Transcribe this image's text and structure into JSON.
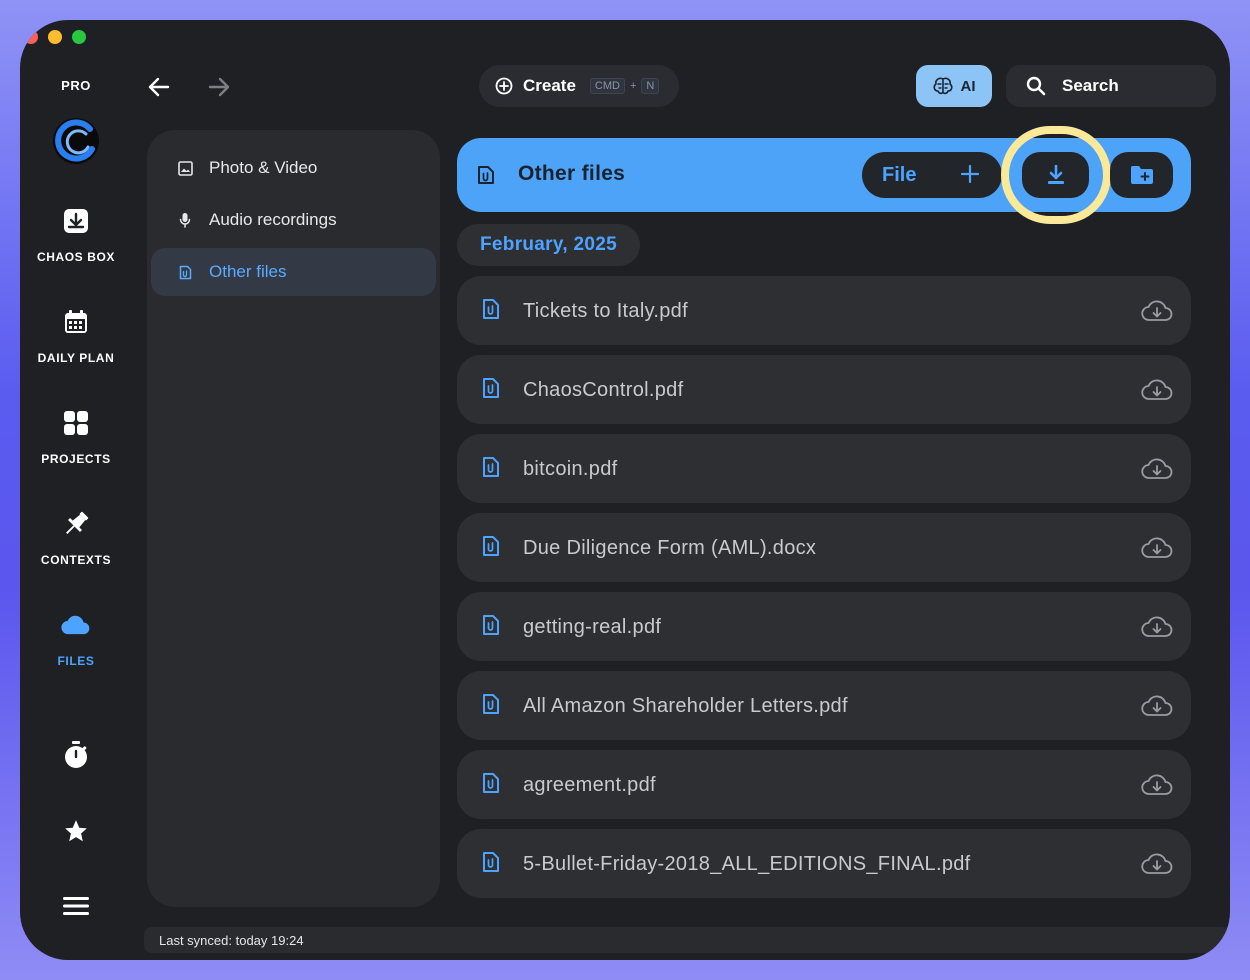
{
  "rail": {
    "plan_label": "PRO",
    "items": [
      {
        "label": "CHAOS BOX",
        "icon": "inbox-download-icon"
      },
      {
        "label": "DAILY PLAN",
        "icon": "calendar-icon"
      },
      {
        "label": "PROJECTS",
        "icon": "grid-icon"
      },
      {
        "label": "CONTEXTS",
        "icon": "pushpin-icon"
      },
      {
        "label": "FILES",
        "icon": "cloud-icon",
        "active": true
      }
    ],
    "bottom_icons": [
      "timer-icon",
      "star-icon",
      "menu-icon"
    ]
  },
  "topbar": {
    "create_label": "Create",
    "shortcut_key1": "CMD",
    "shortcut_plus": "+",
    "shortcut_key2": "N",
    "ai_label": "AI",
    "search_label": "Search"
  },
  "subnav": {
    "items": [
      {
        "label": "Photo & Video",
        "icon": "image-icon"
      },
      {
        "label": "Audio recordings",
        "icon": "microphone-icon"
      },
      {
        "label": "Other files",
        "icon": "attachment-file-icon",
        "active": true
      }
    ]
  },
  "main": {
    "header_title": "Other files",
    "file_button_label": "File",
    "date_group": "February, 2025",
    "files": [
      "Tickets to Italy.pdf",
      "ChaosControl.pdf",
      "bitcoin.pdf",
      "Due Diligence Form (AML).docx",
      "getting-real.pdf",
      "All Amazon Shareholder Letters.pdf",
      "agreement.pdf",
      "5-Bullet-Friday-2018_ALL_EDITIONS_FINAL.pdf"
    ]
  },
  "status": {
    "text": "Last synced: today 19:24"
  },
  "colors": {
    "accent": "#4da3f7",
    "highlight_ring": "#fbe99a",
    "window_bg": "#1f2023"
  }
}
